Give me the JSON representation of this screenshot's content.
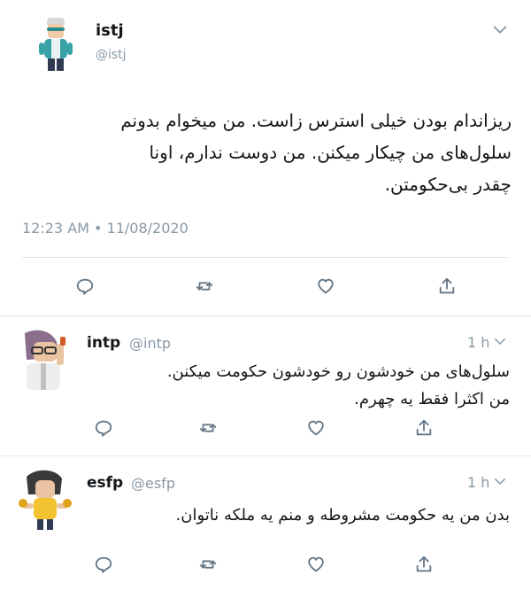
{
  "main_tweet": {
    "name": "istj",
    "handle": "@istj",
    "text_lines": [
      "ریزاندام بودن خیلی استرس زاست.  من میخوام بدونم",
      "سلول‌های من چیکار میکنن.  من دوست ندارم، اونا",
      "چقدر بی‌حکومتن."
    ],
    "timestamp": "12:23 AM • 11/08/2020"
  },
  "replies": [
    {
      "name": "intp",
      "handle": "@intp",
      "time": "1 h",
      "text_lines": [
        "سلول‌های من خودشون رو خودشون حکومت میکنن.",
        "من اکثرا فقط یه چهرم."
      ]
    },
    {
      "name": "esfp",
      "handle": "@esfp",
      "time": "1 h",
      "text_lines": [
        "بدن من یه حکومت مشروطه و منم یه ملکه ناتوان."
      ]
    }
  ],
  "icons": {
    "reply": "reply-icon",
    "retweet": "retweet-icon",
    "like": "like-icon",
    "share": "share-icon",
    "menu": "chevron-down-icon"
  },
  "colors": {
    "text": "#14171a",
    "muted": "#8899a6",
    "divider": "#e1e8ed"
  }
}
